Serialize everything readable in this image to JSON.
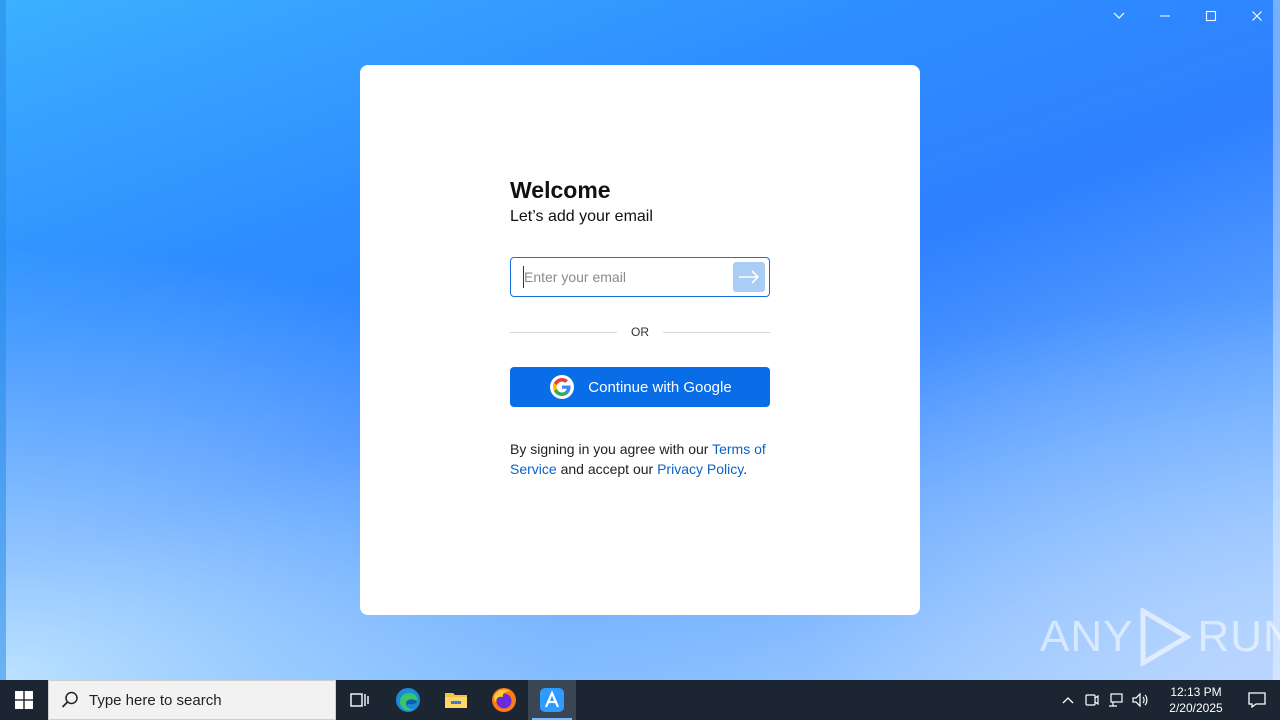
{
  "window": {
    "controls": [
      "dropdown",
      "minimize",
      "maximize",
      "close"
    ]
  },
  "login": {
    "title": "Welcome",
    "subtitle": "Let’s add your email",
    "email_placeholder": "Enter your email",
    "email_value": "",
    "or_label": "OR",
    "google_button_label": "Continue with Google",
    "terms": {
      "prefix": "By signing in you agree with our ",
      "terms_link": "Terms of Service",
      "middle": " and accept our ",
      "privacy_link": "Privacy Policy",
      "suffix": "."
    }
  },
  "watermark": {
    "left": "ANY",
    "right": "RUN"
  },
  "taskbar": {
    "search_placeholder": "Type here to search",
    "apps": [
      "task-view",
      "edge",
      "file-explorer",
      "firefox",
      "active-app"
    ],
    "clock": {
      "time": "12:13 PM",
      "date": "2/20/2025"
    }
  },
  "colors": {
    "primary": "#0a6de8",
    "link": "#0a62c9",
    "taskbar": "#1c2632"
  }
}
